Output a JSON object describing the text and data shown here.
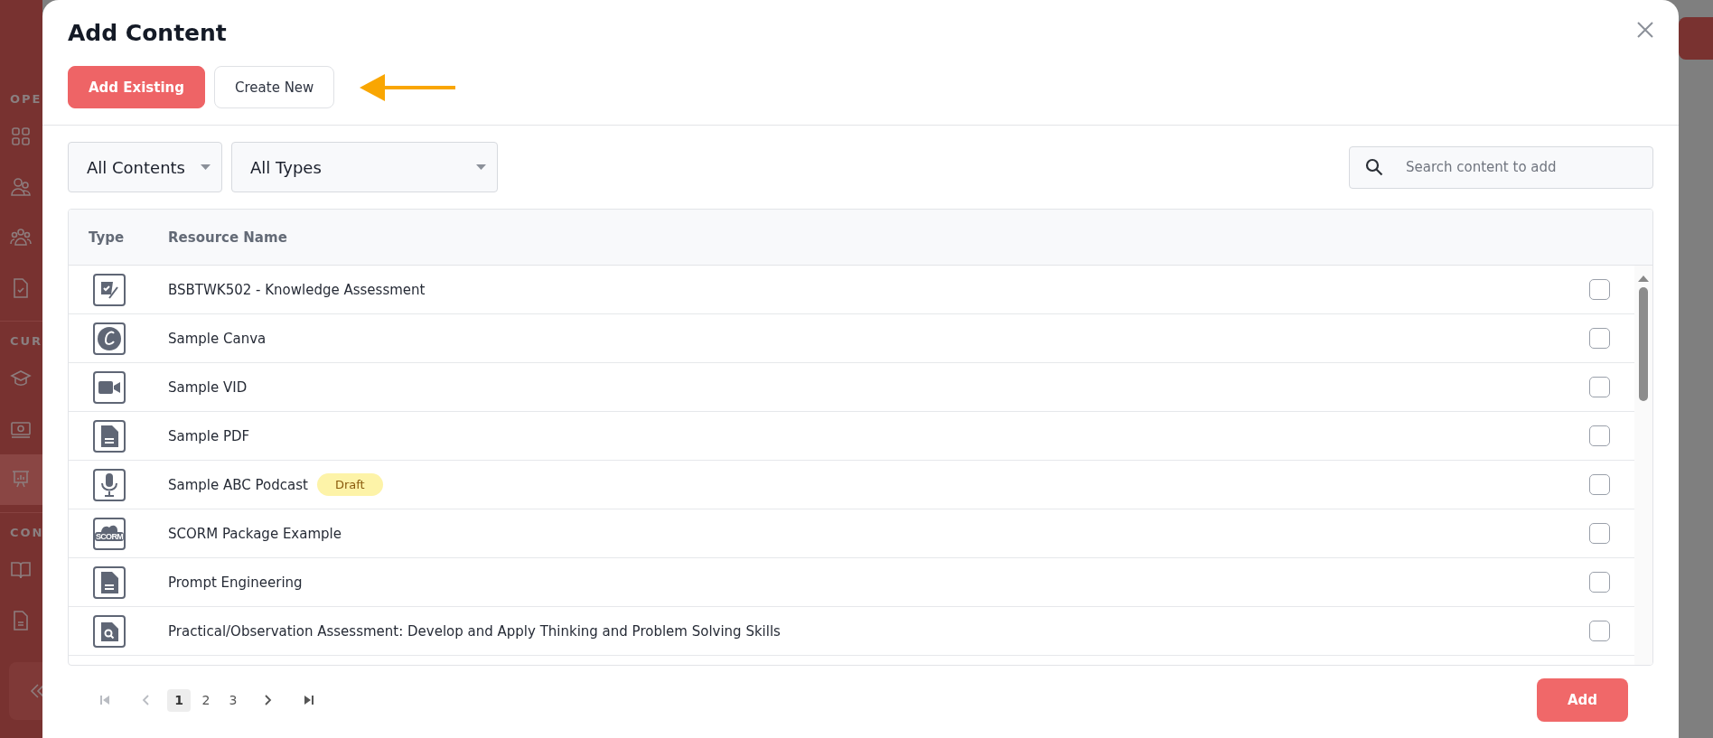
{
  "sidebar": {
    "sections": [
      {
        "label": "OPE",
        "items": [
          {
            "kind": "grid",
            "selected": false
          },
          {
            "kind": "users",
            "selected": false
          },
          {
            "kind": "group",
            "selected": false
          },
          {
            "kind": "checkdoc",
            "selected": false
          }
        ]
      },
      {
        "label": "CUR",
        "items": [
          {
            "kind": "cap",
            "selected": false
          },
          {
            "kind": "money",
            "selected": false
          },
          {
            "kind": "presentation",
            "selected": true
          }
        ]
      },
      {
        "label": "CON",
        "items": [
          {
            "kind": "book",
            "selected": false
          },
          {
            "kind": "doc",
            "selected": false
          }
        ]
      }
    ]
  },
  "dialog": {
    "title": "Add Content",
    "tabs": [
      {
        "label": "Add Existing",
        "selected": true
      },
      {
        "label": "Create New",
        "selected": false
      }
    ],
    "filters": [
      {
        "value": "All Contents"
      },
      {
        "value": "All Types"
      }
    ],
    "search": {
      "placeholder": "Search content to add"
    },
    "table": {
      "columns": [
        "Type",
        "Resource Name"
      ],
      "rows": [
        {
          "kind": "assessment",
          "name": "BSBTWK502 - Knowledge Assessment",
          "checked": false
        },
        {
          "kind": "canva",
          "name": "Sample Canva",
          "checked": false
        },
        {
          "kind": "video",
          "name": "Sample VID",
          "checked": false
        },
        {
          "kind": "document",
          "name": "Sample PDF",
          "checked": false
        },
        {
          "kind": "audio",
          "name": "Sample ABC Podcast",
          "badge": "Draft",
          "checked": false
        },
        {
          "kind": "scorm",
          "icon_text": "SCORM",
          "name": "SCORM Package Example",
          "checked": false
        },
        {
          "kind": "document",
          "name": "Prompt Engineering",
          "checked": false
        },
        {
          "kind": "observation",
          "name": "Practical/Observation Assessment: Develop and Apply Thinking and Problem Solving Skills",
          "checked": false
        }
      ]
    },
    "pagination": {
      "first": {
        "disabled": true
      },
      "prev": {
        "disabled": true
      },
      "pages": [
        {
          "label": "1",
          "selected": true
        },
        {
          "label": "2",
          "selected": false
        },
        {
          "label": "3",
          "selected": false
        }
      ],
      "next": {
        "disabled": false
      },
      "last": {
        "disabled": false
      }
    },
    "submit": "Add"
  }
}
